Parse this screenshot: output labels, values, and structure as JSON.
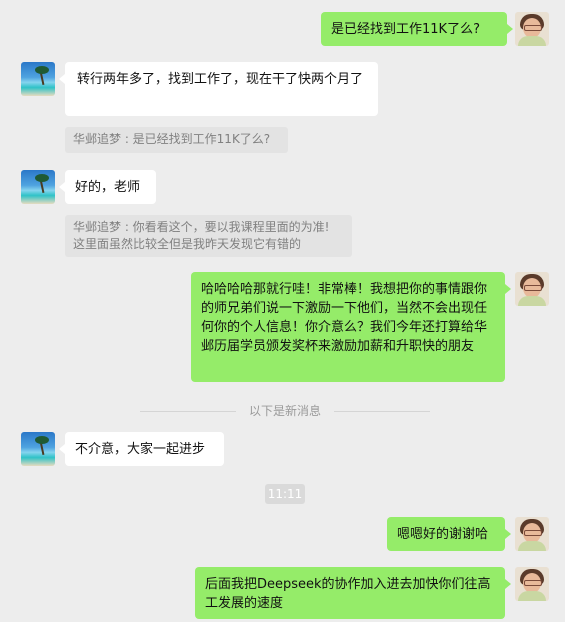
{
  "messages": [
    {
      "side": "right",
      "text": "是已经找到工作11K了么?"
    },
    {
      "side": "left",
      "text": "转行两年多了，找到工作了，现在干了快两个月了"
    },
    {
      "side": "left",
      "text": "好的，老师"
    },
    {
      "side": "right",
      "text": "哈哈哈哈那就行哇！非常棒！我想把你的事情跟你的师兄弟们说一下激励一下他们，当然不会出现任何你的个人信息！你介意么？我们今年还打算给华邺历届学员颁发奖杯来激励加薪和升职快的朋友"
    },
    {
      "side": "left",
      "text": "不介意，大家一起进步"
    },
    {
      "side": "right",
      "text": "嗯嗯好的谢谢哈"
    },
    {
      "side": "right",
      "text": "后面我把Deepseek的协作加入进去加快你们往高工发展的速度"
    }
  ],
  "quotes": [
    "华邺追梦 : 是已经找到工作11K了么?",
    "华邺追梦 : 你看看这个，要以我课程里面的为准!",
    "这里面虽然比较全但是我昨天发现它有错的"
  ],
  "divider_text": "以下是新消息",
  "timestamp": "11:11",
  "colors": {
    "background": "#ededed",
    "my_bubble": "#95ec69",
    "their_bubble": "#ffffff"
  }
}
